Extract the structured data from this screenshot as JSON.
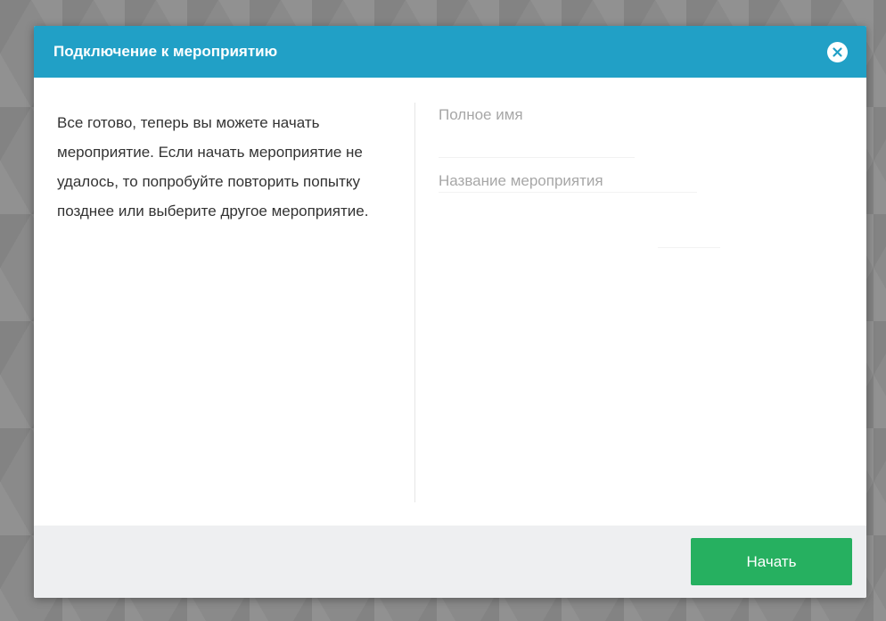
{
  "dialog": {
    "title": "Подключение к мероприятию",
    "close_icon": "close-circle-icon"
  },
  "body": {
    "info_text": "Все готово, теперь вы можете начать мероприятие. Если начать мероприятие не удалось, то попробуйте повторить попытку позднее или выберите другое мероприятие.",
    "full_name": {
      "value": "",
      "placeholder": "Полное имя"
    },
    "event_name": {
      "value": "",
      "placeholder": "Название мероприятия"
    }
  },
  "footer": {
    "start_label": "Начать"
  },
  "colors": {
    "header": "#21a0c6",
    "primary_button": "#26b060",
    "footer": "#eeeff1",
    "backdrop": "#8a8a8a"
  }
}
